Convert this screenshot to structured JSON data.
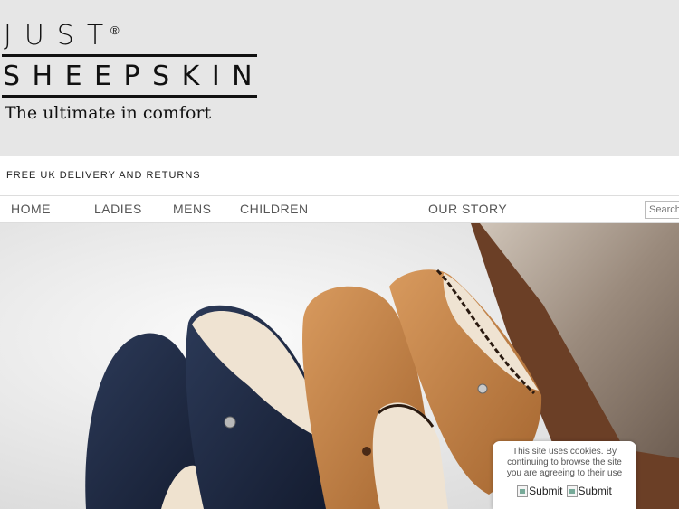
{
  "logo": {
    "line1": "JUST",
    "registered": "®",
    "line2": "SHEEPSKIN",
    "tagline": "The ultimate in comfort"
  },
  "promo": {
    "text": "FREE UK DELIVERY AND RETURNS"
  },
  "nav": {
    "items": [
      {
        "label": "HOME"
      },
      {
        "label": "LADIES"
      },
      {
        "label": "MENS"
      },
      {
        "label": "CHILDREN"
      },
      {
        "label": "OUR STORY"
      }
    ],
    "search_placeholder": "Search"
  },
  "hero": {
    "description_icon": "slippers-hero-image"
  },
  "cookie": {
    "text": "This site uses cookies. By continuing to browse the site you are agreeing to their use",
    "buttons": [
      {
        "label": "Submit"
      },
      {
        "label": "Submit"
      }
    ]
  },
  "colors": {
    "header_bg": "#e6e6e6",
    "navy_slipper": "#1e2a44",
    "tan_slipper": "#c27f45",
    "fleece": "#f2ece4"
  }
}
